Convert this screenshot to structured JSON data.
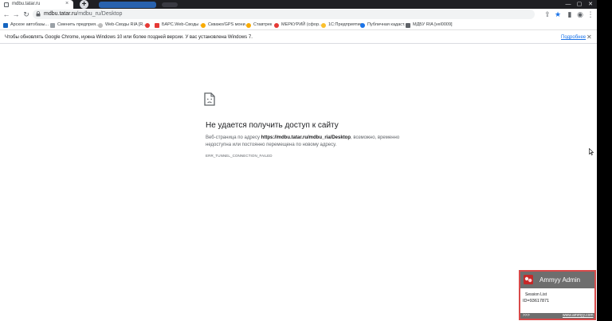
{
  "tabs": [
    {
      "title": "mdbu.tatar.ru",
      "active": true
    }
  ],
  "window_controls": {
    "minimize": "—",
    "maximize": "▢",
    "close": "✕"
  },
  "toolbar": {
    "url_host": "mdbu.tatar.ru",
    "url_path": "/mdbu_ru/Desktop"
  },
  "bookmarks": [
    {
      "label": "Арское автобазы...",
      "color": "#1565c0"
    },
    {
      "label": "Сменить предприя...",
      "color": "#5f6368"
    },
    {
      "label": "Web-Своды RIA [R...",
      "color": "#9aa0a6"
    },
    {
      "label": "",
      "color": "#e53935"
    },
    {
      "label": "БАРС.Web-Своды ...",
      "color": "#e53935"
    },
    {
      "label": "Скважо/GPS мони...",
      "color": "#f9ab00"
    },
    {
      "label": "Ставтрек",
      "color": "#f9ab00"
    },
    {
      "label": "МЕРКУРИЙ (сфор...",
      "color": "#e53935"
    },
    {
      "label": "1С:Предприятие",
      "color": "#fbc02d"
    },
    {
      "label": "Публичная кадаст...",
      "color": "#1a73e8"
    },
    {
      "label": "МДБУ RIA [vel0009]",
      "color": "#5f6368"
    }
  ],
  "infobar": {
    "message": "Чтобы обновлять Google Chrome, нужна Windows 10 или более поздней версии. У вас установлена Windows 7.",
    "link": "Подробнее"
  },
  "error_page": {
    "title": "Не удается получить доступ к сайту",
    "body_prefix": "Веб-страница по адресу ",
    "body_url": "https://mdbu.tatar.ru/mdbu_ria/Desktop",
    "body_suffix": ", возможно, временно недоступна или постоянно перемещена по новому адресу.",
    "code": "ERR_TUNNEL_CONNECTION_FAILED"
  },
  "ammyy": {
    "title": "Ammyy Admin",
    "session_list": "Session List",
    "id": "ID=93617871",
    "footer_arrows": ">>>",
    "site": "www.ammyy.com",
    "accent": "#d84a4a"
  }
}
